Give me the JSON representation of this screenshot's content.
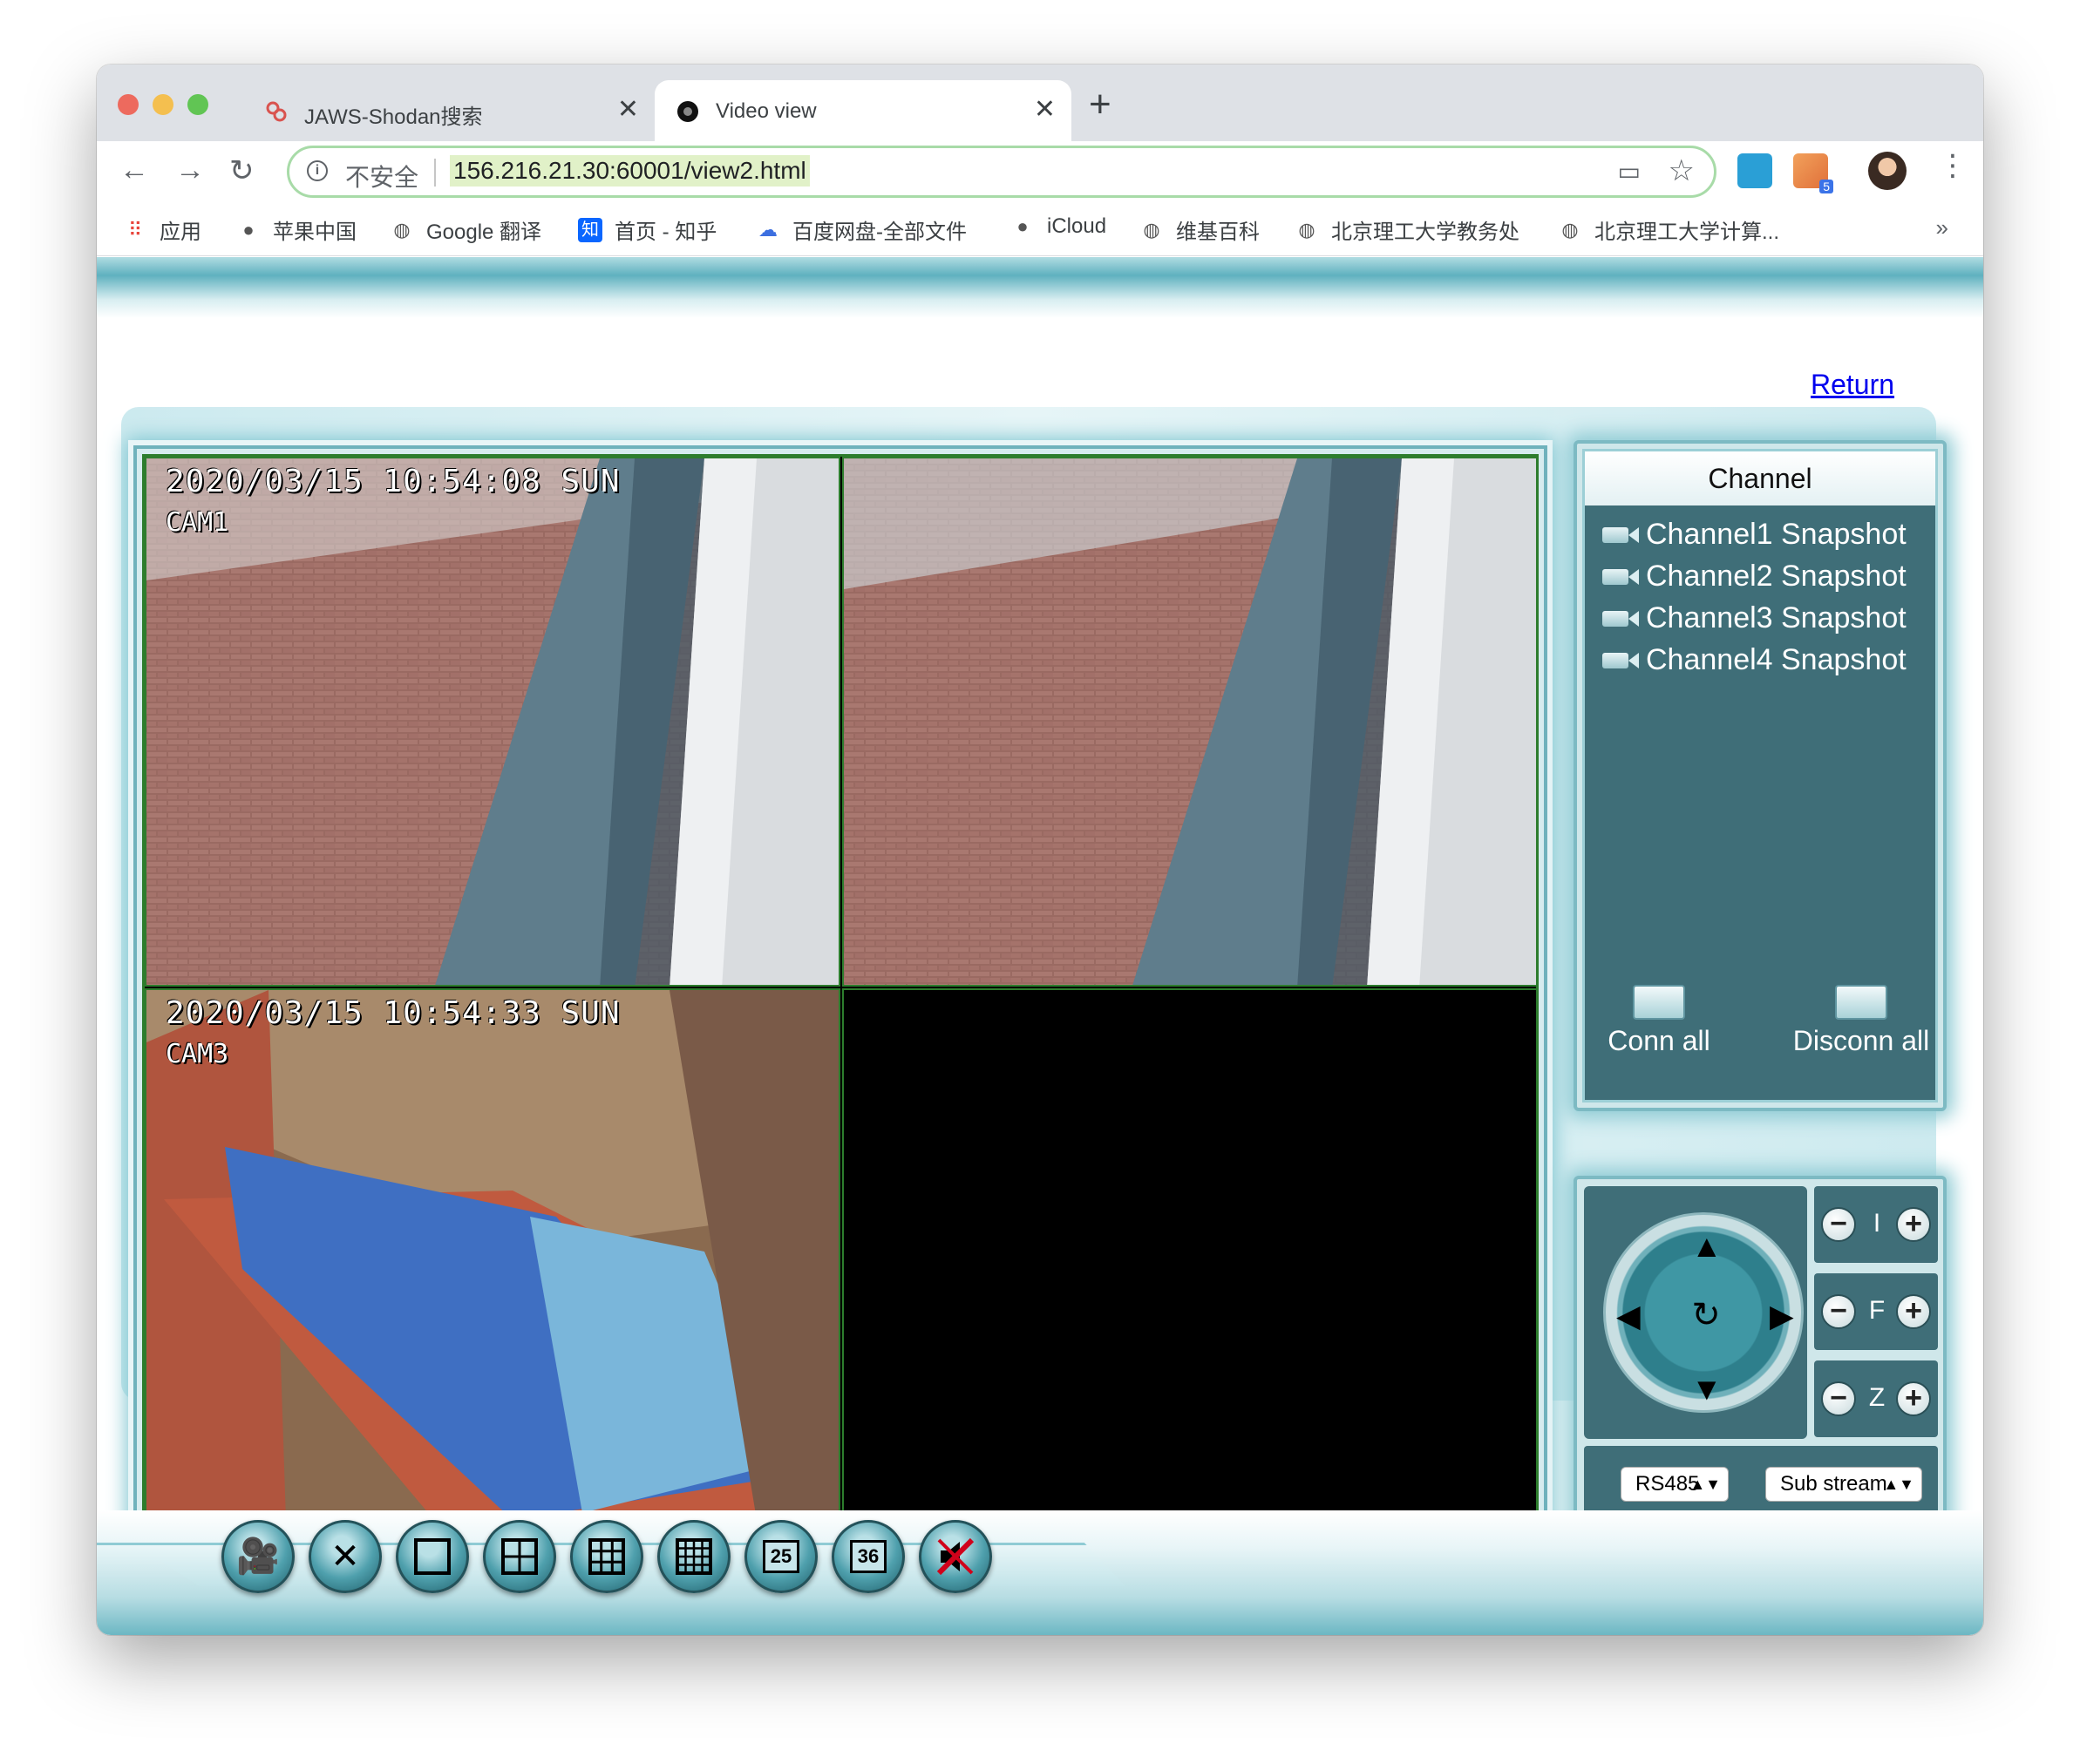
{
  "browser": {
    "tabs": [
      {
        "title": "JAWS-Shodan搜索",
        "active": false
      },
      {
        "title": "Video view",
        "active": true
      }
    ],
    "address": {
      "security_label": "不安全",
      "url": "156.216.21.30:60001/view2.html"
    },
    "extension_badge": "5",
    "bookmarks": [
      {
        "label": "应用",
        "icon": "apps-grid-icon"
      },
      {
        "label": "苹果中国",
        "icon": "apple-icon"
      },
      {
        "label": "Google 翻译",
        "icon": "globe-icon"
      },
      {
        "label": "首页 - 知乎",
        "icon": "zhihu-icon",
        "icon_text": "知"
      },
      {
        "label": "百度网盘-全部文件",
        "icon": "baidu-cloud-icon"
      },
      {
        "label": "iCloud",
        "icon": "apple-icon"
      },
      {
        "label": "维基百科",
        "icon": "globe-icon"
      },
      {
        "label": "北京理工大学教务处",
        "icon": "globe-icon"
      },
      {
        "label": "北京理工大学计算...",
        "icon": "globe-icon"
      }
    ],
    "more_bookmarks": "»"
  },
  "page": {
    "return_link": "Return",
    "video_cells": [
      {
        "timestamp": "2020/03/15  10:54:08  SUN",
        "cam": "CAM1"
      },
      {
        "timestamp": "",
        "cam": ""
      },
      {
        "timestamp": "2020/03/15  10:54:33  SUN",
        "cam": "CAM3"
      },
      {
        "timestamp": "",
        "cam": ""
      }
    ],
    "channel_panel": {
      "title": "Channel",
      "items": [
        "Channel1 Snapshot",
        "Channel2 Snapshot",
        "Channel3 Snapshot",
        "Channel4 Snapshot"
      ],
      "conn_all": "Conn all",
      "disconn_all": "Disconn all"
    },
    "ptz": {
      "iris_label": "I",
      "focus_label": "F",
      "zoom_label": "Z",
      "protocol_select": "RS485",
      "stream_select": "Sub stream"
    },
    "toolbar_buttons": [
      {
        "name": "record-icon",
        "text": ""
      },
      {
        "name": "settings-tools-icon",
        "text": ""
      },
      {
        "name": "layout-1-icon",
        "text": ""
      },
      {
        "name": "layout-4-icon",
        "text": ""
      },
      {
        "name": "layout-9-icon",
        "text": ""
      },
      {
        "name": "layout-16-icon",
        "text": ""
      },
      {
        "name": "layout-25-icon",
        "text": "25"
      },
      {
        "name": "layout-36-icon",
        "text": "36"
      },
      {
        "name": "mute-icon",
        "text": ""
      }
    ]
  },
  "colors": {
    "panel_teal": "#3f6e78",
    "grid_border": "#2d7d2d",
    "link": "#0000ee"
  }
}
